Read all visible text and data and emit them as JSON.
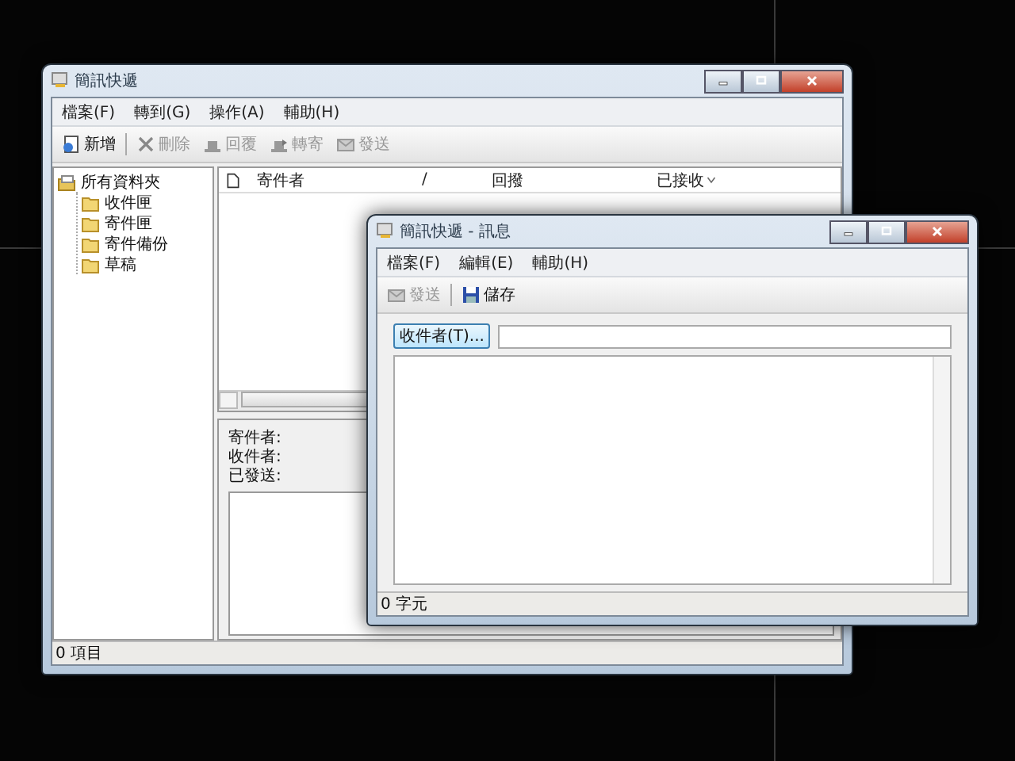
{
  "main_window": {
    "title": "簡訊快遞",
    "menu": [
      "檔案(F)",
      "轉到(G)",
      "操作(A)",
      "輔助(H)"
    ],
    "toolbar": [
      {
        "label": "新增",
        "disabled": false
      },
      {
        "label": "刪除",
        "disabled": true
      },
      {
        "label": "回覆",
        "disabled": true
      },
      {
        "label": "轉寄",
        "disabled": true
      },
      {
        "label": "發送",
        "disabled": true
      }
    ],
    "folders": [
      {
        "label": "所有資料夾",
        "children": [
          {
            "label": "收件匣"
          },
          {
            "label": "寄件匣"
          },
          {
            "label": "寄件備份"
          },
          {
            "label": "草稿"
          }
        ]
      }
    ],
    "columns": [
      {
        "label": "寄件者",
        "sorted": false
      },
      {
        "label": "/",
        "sorted": false
      },
      {
        "label": "回撥",
        "sorted": false
      },
      {
        "label": "已接收",
        "sorted": true
      }
    ],
    "preview_fields": [
      "寄件者:",
      "收件者:",
      "已發送:"
    ],
    "status_bar": "0 項目"
  },
  "message_window": {
    "title": "簡訊快遞 - 訊息",
    "menu": [
      "檔案(F)",
      "編輯(E)",
      "輔助(H)"
    ],
    "toolbar": [
      {
        "label": "發送",
        "disabled": true
      },
      {
        "label": "儲存",
        "disabled": false
      }
    ],
    "recipient_button": "收件者(T)...",
    "status_bar": "0 字元"
  }
}
